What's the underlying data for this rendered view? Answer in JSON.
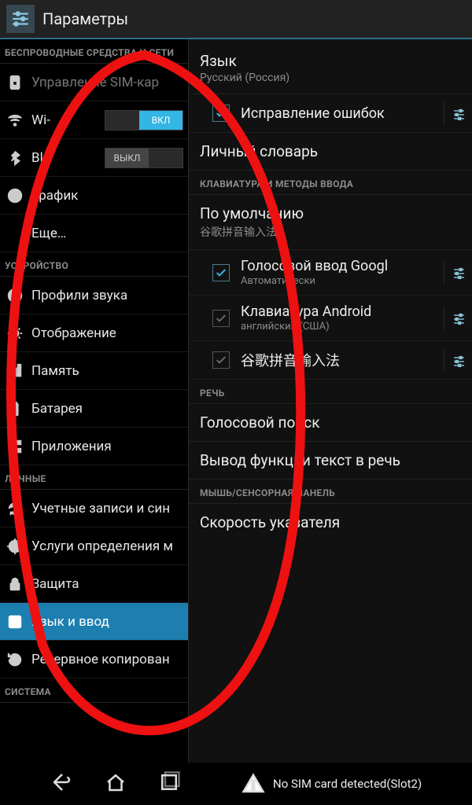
{
  "titlebar": {
    "title": "Параметры"
  },
  "sidebar": {
    "sections": [
      {
        "header": "БЕСПРОВОДНЫЕ СРЕДСТВА И СЕТИ",
        "items": [
          {
            "icon": "sim-icon",
            "label": "Управление SIM-кар",
            "dim": true
          },
          {
            "icon": "wifi-icon",
            "label": "Wi-",
            "toggle": {
              "state": "on",
              "text": "ВКЛ"
            }
          },
          {
            "icon": "bluetooth-icon",
            "label": "Blu",
            "toggle": {
              "state": "off",
              "text": "ВЫКЛ"
            }
          },
          {
            "icon": "traffic-icon",
            "label": "Трафик"
          },
          {
            "icon": "",
            "label": "Еще…"
          }
        ]
      },
      {
        "header": "УСТРОЙСТВО",
        "items": [
          {
            "icon": "sound-icon",
            "label": "Профили звука"
          },
          {
            "icon": "display-icon",
            "label": "Отображение"
          },
          {
            "icon": "storage-icon",
            "label": "Память"
          },
          {
            "icon": "battery-icon",
            "label": "Батарея"
          },
          {
            "icon": "apps-icon",
            "label": "Приложения"
          }
        ]
      },
      {
        "header": "ЛИЧНЫЕ",
        "items": [
          {
            "icon": "sync-icon",
            "label": "Учетные записи и син"
          },
          {
            "icon": "location-icon",
            "label": "Услуги определения м"
          },
          {
            "icon": "lock-icon",
            "label": "Защита"
          },
          {
            "icon": "lang-icon",
            "label": "Язык и ввод",
            "active": true
          },
          {
            "icon": "backup-icon",
            "label": "Резервное копирован"
          }
        ]
      },
      {
        "header": "СИСТЕМА",
        "items": []
      }
    ]
  },
  "content": {
    "language": {
      "title": "Язык",
      "value": "Русский (Россия)"
    },
    "spellcheck": {
      "label": "Исправление ошибок",
      "checked": true,
      "sliders": true
    },
    "personal_dict": {
      "label": "Личный словарь"
    },
    "kbd_header": "КЛАВИАТУРА И МЕТОДЫ ВВОДА",
    "default_kbd": {
      "title": "По умолчанию",
      "sub": "谷歌拼音输入法"
    },
    "kbds": [
      {
        "label": "Голосовой ввод Googl",
        "sub": "Автоматически",
        "checked": true,
        "active": true
      },
      {
        "label": "Клавиатура Android",
        "sub": "английский (США)",
        "checked": true,
        "active": false
      },
      {
        "label": "谷歌拼音输入法",
        "sub": "",
        "checked": true,
        "active": false
      }
    ],
    "speech_header": "РЕЧЬ",
    "voice_search": "Голосовой поиск",
    "tts": "Вывод функции текст в речь",
    "mouse_header": "МЫШЬ/СЕНСОРНАЯ ПАНЕЛЬ",
    "pointer_speed": "Скорость указателя"
  },
  "statusbar": {
    "message": "No SIM card detected(Slot2)"
  }
}
